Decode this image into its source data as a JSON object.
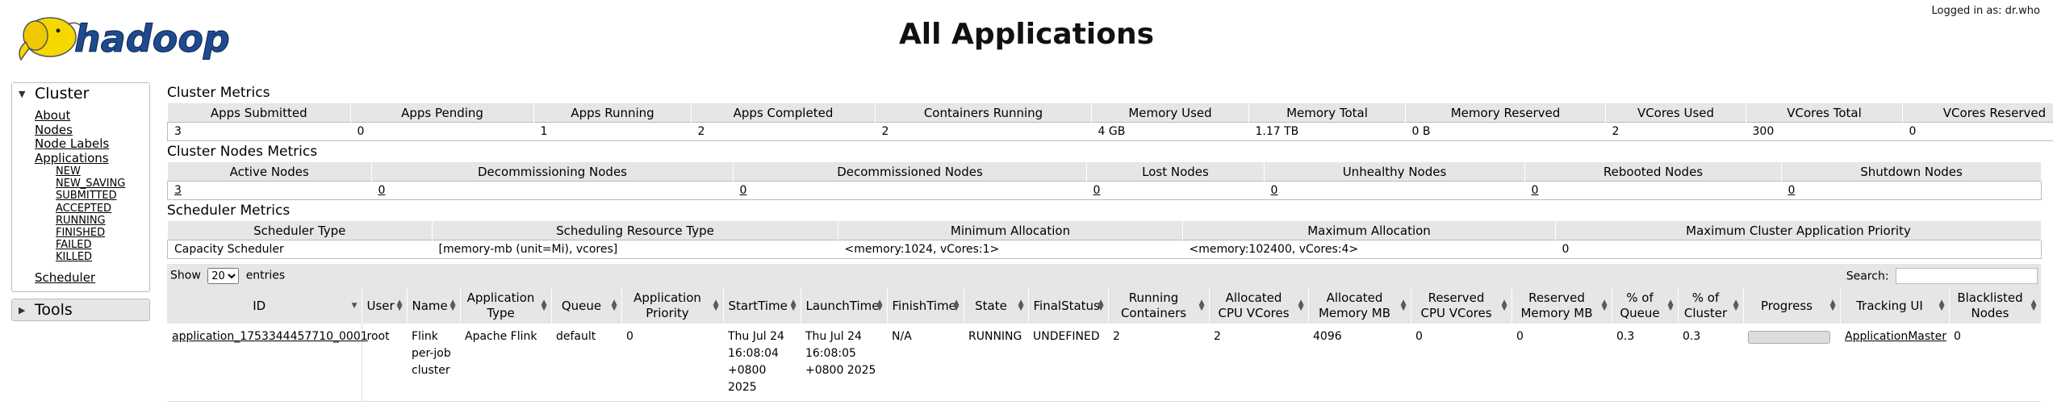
{
  "header": {
    "title": "All Applications",
    "logo_text": "hadoop",
    "login_text": "Logged in as: dr.who"
  },
  "sidebar": {
    "cluster_label": "Cluster",
    "links": [
      "About",
      "Nodes",
      "Node Labels",
      "Applications"
    ],
    "app_states": [
      "NEW",
      "NEW_SAVING",
      "SUBMITTED",
      "ACCEPTED",
      "RUNNING",
      "FINISHED",
      "FAILED",
      "KILLED"
    ],
    "scheduler_label": "Scheduler",
    "tools_label": "Tools"
  },
  "cluster_metrics": {
    "title": "Cluster Metrics",
    "headers": [
      "Apps Submitted",
      "Apps Pending",
      "Apps Running",
      "Apps Completed",
      "Containers Running",
      "Memory Used",
      "Memory Total",
      "Memory Reserved",
      "VCores Used",
      "VCores Total",
      "VCores Reserved"
    ],
    "values": [
      "3",
      "0",
      "1",
      "2",
      "2",
      "4 GB",
      "1.17 TB",
      "0 B",
      "2",
      "300",
      "0"
    ]
  },
  "node_metrics": {
    "title": "Cluster Nodes Metrics",
    "headers": [
      "Active Nodes",
      "Decommissioning Nodes",
      "Decommissioned Nodes",
      "Lost Nodes",
      "Unhealthy Nodes",
      "Rebooted Nodes",
      "Shutdown Nodes"
    ],
    "values": [
      "3",
      "0",
      "0",
      "0",
      "0",
      "0",
      "0"
    ]
  },
  "scheduler_metrics": {
    "title": "Scheduler Metrics",
    "headers": [
      "Scheduler Type",
      "Scheduling Resource Type",
      "Minimum Allocation",
      "Maximum Allocation",
      "Maximum Cluster Application Priority"
    ],
    "values": [
      "Capacity Scheduler",
      "[memory-mb (unit=Mi), vcores]",
      "<memory:1024, vCores:1>",
      "<memory:102400, vCores:4>",
      "0"
    ]
  },
  "apps_table": {
    "show_label": "Show",
    "entries_value": "20",
    "entries_label": "entries",
    "search_label": "Search:",
    "columns": [
      "ID",
      "User",
      "Name",
      "Application Type",
      "Queue",
      "Application Priority",
      "StartTime",
      "LaunchTime",
      "FinishTime",
      "State",
      "FinalStatus",
      "Running Containers",
      "Allocated CPU VCores",
      "Allocated Memory MB",
      "Reserved CPU VCores",
      "Reserved Memory MB",
      "% of Queue",
      "% of Cluster",
      "Progress",
      "Tracking UI",
      "Blacklisted Nodes"
    ],
    "rows": [
      {
        "id": "application_1753344457710_0001",
        "user": "root",
        "name": "Flink per-job cluster",
        "app_type": "Apache Flink",
        "queue": "default",
        "priority": "0",
        "start_time": "Thu Jul 24 16:08:04 +0800 2025",
        "launch_time": "Thu Jul 24 16:08:05 +0800 2025",
        "finish_time": "N/A",
        "state": "RUNNING",
        "final_status": "UNDEFINED",
        "running_containers": "2",
        "alloc_cpu": "2",
        "alloc_mem": "4096",
        "reserved_cpu": "0",
        "reserved_mem": "0",
        "pct_queue": "0.3",
        "pct_cluster": "0.3",
        "progress": 0,
        "tracking_ui": "ApplicationMaster",
        "blacklisted": "0"
      }
    ]
  },
  "colors": {
    "header_bg": "#e6e6e6",
    "border": "#bbbbbb",
    "logo_yellow": "#f5d800",
    "logo_blue": "#1e4b8e"
  },
  "icons": [
    "elephant-logo-icon",
    "triangle-down-icon",
    "triangle-right-icon",
    "sort-icon"
  ]
}
